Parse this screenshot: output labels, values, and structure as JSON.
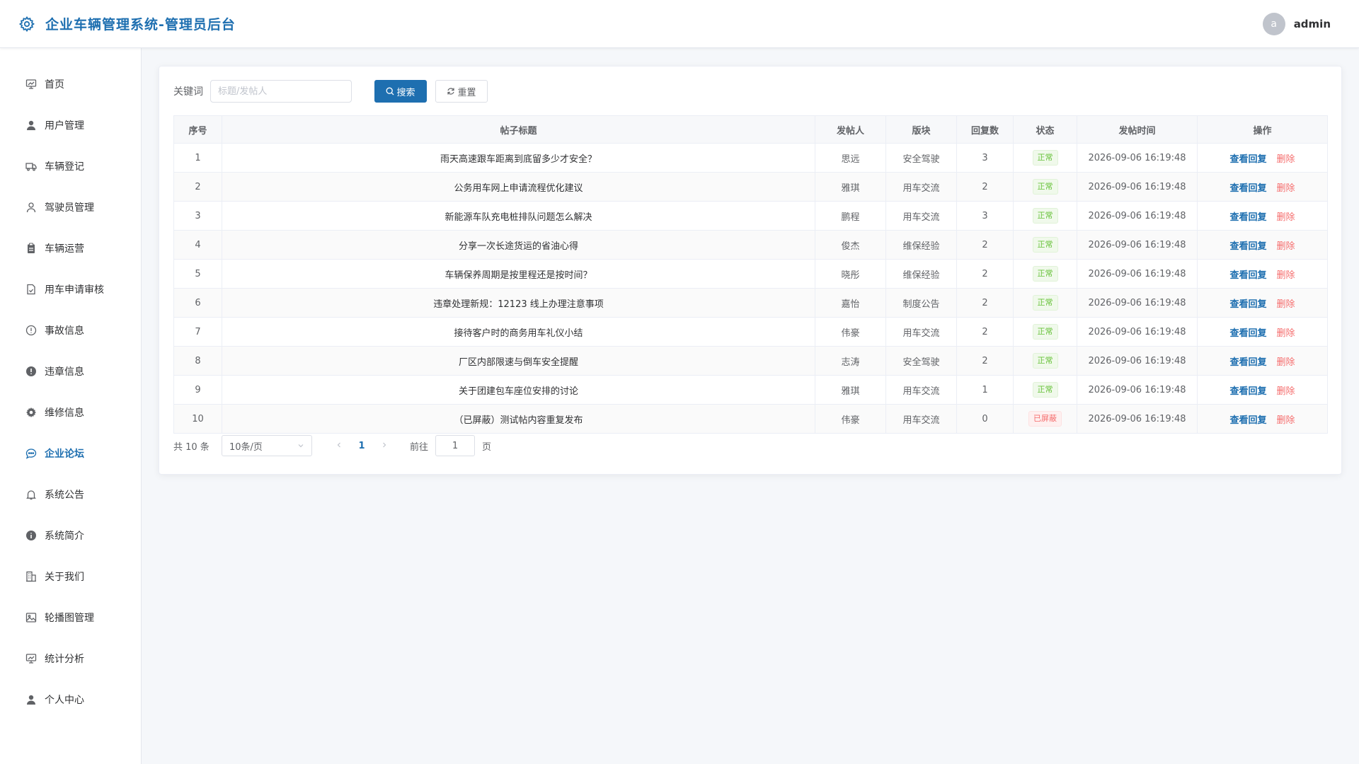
{
  "header": {
    "title": "企业车辆管理系统-管理员后台",
    "avatar_letter": "a",
    "username": "admin"
  },
  "sidebar": {
    "items": [
      {
        "label": "首页",
        "icon": "dashboard-icon"
      },
      {
        "label": "用户管理",
        "icon": "user-icon"
      },
      {
        "label": "车辆登记",
        "icon": "truck-icon"
      },
      {
        "label": "驾驶员管理",
        "icon": "person-icon"
      },
      {
        "label": "车辆运营",
        "icon": "clipboard-icon"
      },
      {
        "label": "用车申请审核",
        "icon": "document-check-icon"
      },
      {
        "label": "事故信息",
        "icon": "warning-circle-icon"
      },
      {
        "label": "违章信息",
        "icon": "alert-filled-icon"
      },
      {
        "label": "维修信息",
        "icon": "gear-icon"
      },
      {
        "label": "企业论坛",
        "icon": "chat-icon"
      },
      {
        "label": "系统公告",
        "icon": "bell-icon"
      },
      {
        "label": "系统简介",
        "icon": "info-icon"
      },
      {
        "label": "关于我们",
        "icon": "building-icon"
      },
      {
        "label": "轮播图管理",
        "icon": "image-icon"
      },
      {
        "label": "统计分析",
        "icon": "chart-icon"
      },
      {
        "label": "个人中心",
        "icon": "user-icon"
      }
    ],
    "active": "企业论坛"
  },
  "search": {
    "label": "关键词",
    "placeholder": "标题/发帖人",
    "value": "",
    "search_label": "搜索",
    "reset_label": "重置"
  },
  "table": {
    "columns": [
      "序号",
      "帖子标题",
      "发帖人",
      "版块",
      "回复数",
      "状态",
      "发帖时间",
      "操作"
    ],
    "rows": [
      {
        "no": "1",
        "title": "雨天高速跟车距离到底留多少才安全？",
        "author": "思远",
        "board": "安全驾驶",
        "replies": "3",
        "status": "正常",
        "time": "2026-09-06 16:19:48",
        "view": "查看回复",
        "del": "删除"
      },
      {
        "no": "2",
        "title": "公务用车网上申请流程优化建议",
        "author": "雅琪",
        "board": "用车交流",
        "replies": "2",
        "status": "正常",
        "time": "2026-09-06 16:19:48",
        "view": "查看回复",
        "del": "删除"
      },
      {
        "no": "3",
        "title": "新能源车队充电桩排队问题怎么解决",
        "author": "鹏程",
        "board": "用车交流",
        "replies": "3",
        "status": "正常",
        "time": "2026-09-06 16:19:48",
        "view": "查看回复",
        "del": "删除"
      },
      {
        "no": "4",
        "title": "分享一次长途货运的省油心得",
        "author": "俊杰",
        "board": "维保经验",
        "replies": "2",
        "status": "正常",
        "time": "2026-09-06 16:19:48",
        "view": "查看回复",
        "del": "删除"
      },
      {
        "no": "5",
        "title": "车辆保养周期是按里程还是按时间？",
        "author": "晓彤",
        "board": "维保经验",
        "replies": "2",
        "status": "正常",
        "time": "2026-09-06 16:19:48",
        "view": "查看回复",
        "del": "删除"
      },
      {
        "no": "6",
        "title": "违章处理新规：12123 线上办理注意事项",
        "author": "嘉怡",
        "board": "制度公告",
        "replies": "2",
        "status": "正常",
        "time": "2026-09-06 16:19:48",
        "view": "查看回复",
        "del": "删除"
      },
      {
        "no": "7",
        "title": "接待客户时的商务用车礼仪小结",
        "author": "伟豪",
        "board": "用车交流",
        "replies": "2",
        "status": "正常",
        "time": "2026-09-06 16:19:48",
        "view": "查看回复",
        "del": "删除"
      },
      {
        "no": "8",
        "title": "厂区内部限速与倒车安全提醒",
        "author": "志涛",
        "board": "安全驾驶",
        "replies": "2",
        "status": "正常",
        "time": "2026-09-06 16:19:48",
        "view": "查看回复",
        "del": "删除"
      },
      {
        "no": "9",
        "title": "关于团建包车座位安排的讨论",
        "author": "雅琪",
        "board": "用车交流",
        "replies": "1",
        "status": "正常",
        "time": "2026-09-06 16:19:48",
        "view": "查看回复",
        "del": "删除"
      },
      {
        "no": "10",
        "title": "（已屏蔽）测试帖内容重复发布",
        "author": "伟豪",
        "board": "用车交流",
        "replies": "0",
        "status": "已屏蔽",
        "time": "2026-09-06 16:19:48",
        "view": "查看回复",
        "del": "删除"
      }
    ]
  },
  "pagination": {
    "total": "共 10 条",
    "page_size": "10条/页",
    "current_page": "1",
    "goto_label": "前往",
    "goto_value": "1",
    "page_unit": "页"
  },
  "colors": {
    "primary": "#1e6fb0",
    "success": "#67c23a",
    "danger": "#f56c6c"
  }
}
